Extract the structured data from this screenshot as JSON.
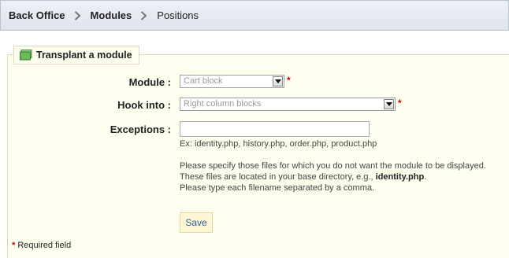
{
  "breadcrumb": {
    "items": [
      "Back Office",
      "Modules",
      "Positions"
    ]
  },
  "panel": {
    "title": "Transplant a module"
  },
  "form": {
    "module_label": "Module :",
    "module_value": "Cart block",
    "hook_label": "Hook into :",
    "hook_value": "Right column blocks",
    "required_mark": "*",
    "exceptions_label": "Exceptions :",
    "exceptions_value": "",
    "example_text": "Ex: identity.php, history.php, order.php, product.php",
    "help_line1": "Please specify those files for which you do not want the module to be displayed.",
    "help_line2_prefix": "These files are located in your base directory, e.g., ",
    "help_line2_bold": "identity.php",
    "help_line2_suffix": ".",
    "help_line3": "Please type each filename separated by a comma.",
    "save_label": "Save"
  },
  "footer": {
    "required_star": "*",
    "required_text": "Required field"
  },
  "colors": {
    "panel_bg": "#fffff0",
    "required": "#cc0000",
    "save_text": "#2b5e9e"
  }
}
